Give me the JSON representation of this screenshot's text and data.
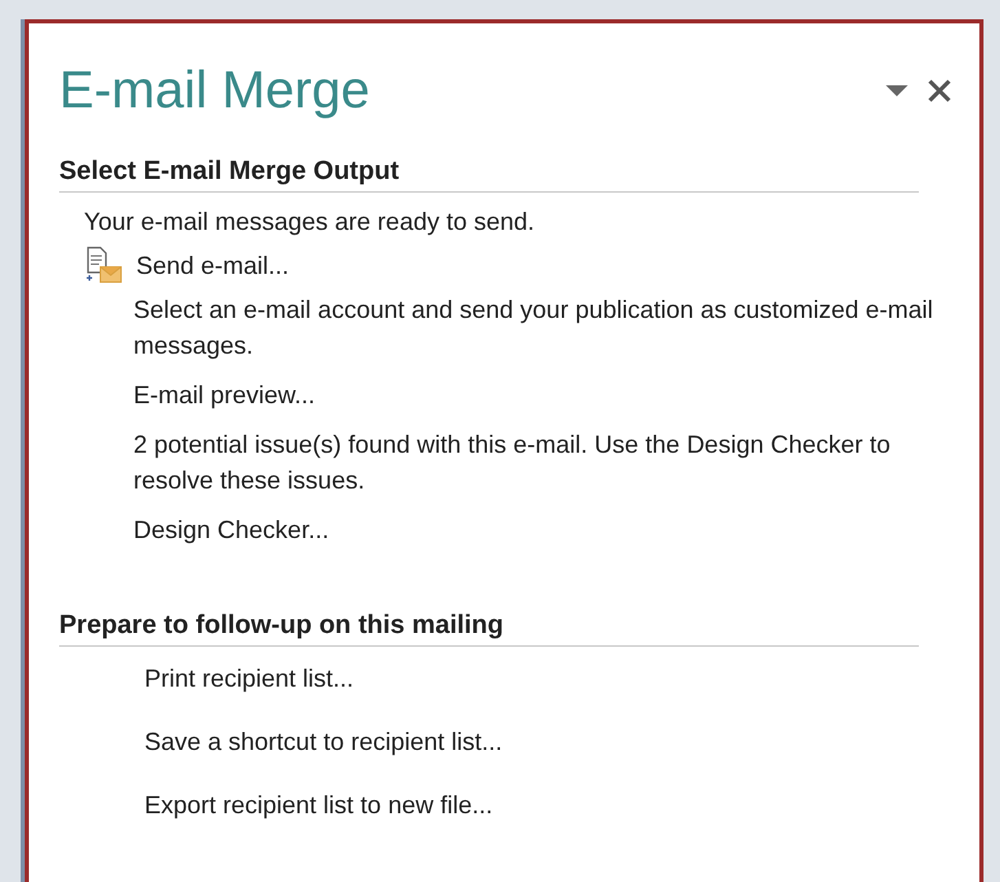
{
  "pane": {
    "title": "E-mail Merge",
    "sections": [
      {
        "heading": "Select E-mail Merge Output",
        "items": [
          {
            "kind": "status",
            "text": "Your e-mail messages are ready to send."
          },
          {
            "kind": "icon-link",
            "text": "Send e-mail..."
          },
          {
            "kind": "note",
            "text": "Select an e-mail account and send your publication as customized e-mail messages."
          },
          {
            "kind": "sublink",
            "text": "E-mail preview..."
          },
          {
            "kind": "note",
            "text": "2 potential issue(s) found with this e-mail. Use the Design Checker to resolve these issues."
          },
          {
            "kind": "sublink",
            "text": "Design Checker..."
          }
        ]
      },
      {
        "heading": "Prepare to follow-up on this mailing",
        "items": [
          {
            "kind": "action",
            "text": "Print recipient list..."
          },
          {
            "kind": "action",
            "text": "Save a shortcut to recipient list..."
          },
          {
            "kind": "action",
            "text": "Export recipient list to new file..."
          }
        ]
      }
    ]
  }
}
